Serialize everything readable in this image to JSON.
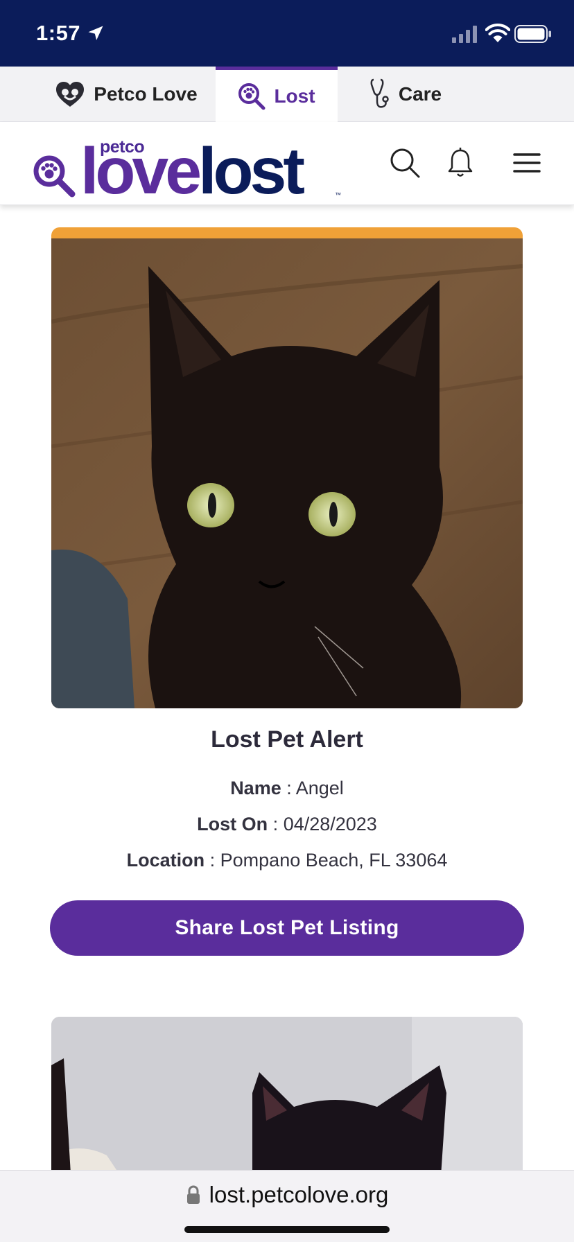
{
  "status_bar": {
    "time": "1:57",
    "location_icon": "location-arrow-icon",
    "signal_icon": "cellular-signal-icon",
    "wifi_icon": "wifi-icon",
    "battery_icon": "battery-icon"
  },
  "brand_tabs": [
    {
      "label": "Petco Love",
      "icon": "heart-pets-icon",
      "active": false
    },
    {
      "label": "Lost",
      "icon": "paw-search-icon",
      "active": true
    },
    {
      "label": "Care",
      "icon": "stethoscope-icon",
      "active": false
    }
  ],
  "header": {
    "logo": {
      "brand": "petco",
      "word_love": "love",
      "word_lost": "lost",
      "tm": "™"
    },
    "icons": [
      "search-icon",
      "bell-icon",
      "menu-icon"
    ]
  },
  "listing": {
    "title": "Lost Pet Alert",
    "name_label": "Name",
    "name_value": "Angel",
    "lost_on_label": "Lost On",
    "lost_on_value": "04/28/2023",
    "location_label": "Location",
    "location_value": "Pompano Beach, FL 33064",
    "share_button": "Share Lost Pet Listing",
    "accent_color": "#f0a137"
  },
  "url_bar": {
    "url": "lost.petcolove.org",
    "lock_icon": "lock-icon"
  },
  "colors": {
    "status_bar": "#0b1c5a",
    "brand_purple": "#5a2d9c",
    "brand_navy": "#0b1c5a"
  }
}
